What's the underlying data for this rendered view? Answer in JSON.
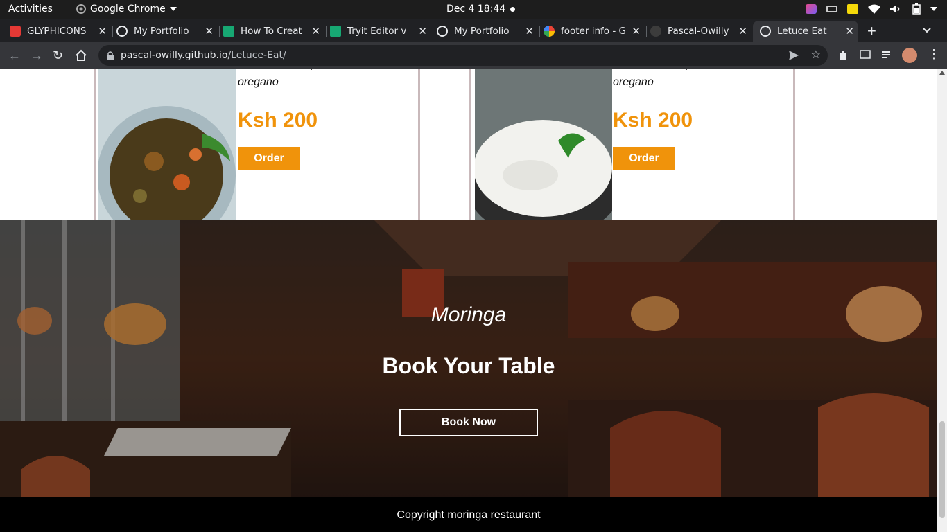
{
  "system_bar": {
    "activities": "Activities",
    "app_name": "Google Chrome",
    "clock": "Dec 4  18:44"
  },
  "tabs": [
    {
      "title": "GLYPHICONS",
      "fav_color": "#e53935"
    },
    {
      "title": "My Portfolio",
      "fav_color": "#e8eaed"
    },
    {
      "title": "How To Creat",
      "fav_color": "#17a873"
    },
    {
      "title": "Tryit Editor v",
      "fav_color": "#17a873"
    },
    {
      "title": "My Portfolio",
      "fav_color": "#e8eaed"
    },
    {
      "title": "footer info - G",
      "fav_color": "#4285f4"
    },
    {
      "title": "Pascal-Owilly",
      "fav_color": "#3c3c3c"
    },
    {
      "title": "Letuce Eat",
      "fav_color": "#e8eaed"
    }
  ],
  "address_bar": {
    "host": "pascal-owilly.github.io",
    "path": "/Letuce-Eat/"
  },
  "menu_cards": [
    {
      "description": "Tomato source, mozzarella & oregano",
      "price": "Ksh 200",
      "order_label": "Order"
    },
    {
      "description": "Tomato source, mozzarella & oregano",
      "price": "Ksh 200",
      "order_label": "Order"
    }
  ],
  "hero": {
    "tagline": "Moringa",
    "heading": "Book Your Table",
    "button_label": "Book Now"
  },
  "footer": {
    "copyright": "Copyright moringa restaurant"
  },
  "colors": {
    "accent": "#f0930b",
    "card_border": "#c9b9bb",
    "footer_bg": "#000000"
  }
}
